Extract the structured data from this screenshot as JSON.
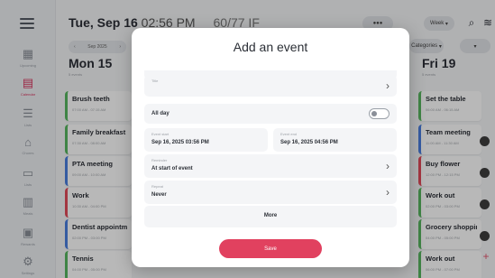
{
  "header": {
    "date": "Tue, Sep 16",
    "time": "02:56 PM",
    "extra": "60/77 IF",
    "view": "Week",
    "categories": "Categories"
  },
  "nav": {
    "range": "Sep 2025"
  },
  "sidebar": {
    "items": [
      {
        "label": "Upcoming",
        "icon": "grid-icon"
      },
      {
        "label": "Calendar",
        "icon": "calendar-icon"
      },
      {
        "label": "Lists",
        "icon": "lists-icon"
      },
      {
        "label": "Chores",
        "icon": "home-icon"
      },
      {
        "label": "Lists",
        "icon": "list-icon"
      },
      {
        "label": "Meals",
        "icon": "meals-icon"
      },
      {
        "label": "Rewards",
        "icon": "rewards-icon"
      },
      {
        "label": "Settings",
        "icon": "settings-icon"
      }
    ]
  },
  "columns": {
    "left": {
      "day": "Mon 15",
      "sub": "5 events",
      "events": [
        {
          "title": "Brush teeth",
          "time": "07:00 AM - 07:15 AM",
          "color": "#58b860"
        },
        {
          "title": "Family breakfast",
          "time": "07:30 AM - 08:00 AM",
          "color": "#58b860"
        },
        {
          "title": "PTA meeting",
          "time": "09:00 AM - 10:00 AM",
          "color": "#4a7fe0"
        },
        {
          "title": "Work",
          "time": "10:30 AM - 04:00 PM",
          "color": "#e24b5a"
        },
        {
          "title": "Dentist appointment",
          "time": "02:00 PM - 03:00 PM",
          "color": "#4a7fe0"
        },
        {
          "title": "Tennis",
          "time": "04:00 PM - 05:00 PM",
          "color": "#58b860"
        }
      ]
    },
    "right": {
      "day": "Fri 19",
      "sub": "5 events",
      "events": [
        {
          "title": "Set the table",
          "time": "06:00 AM - 06:15 AM",
          "color": "#58b860"
        },
        {
          "title": "Team meeting",
          "time": "11:00 AM - 11:30 AM",
          "color": "#4a7fe0"
        },
        {
          "title": "Buy flower",
          "time": "12:00 PM - 12:15 PM",
          "color": "#e24b5a"
        },
        {
          "title": "Work out",
          "time": "02:00 PM - 03:00 PM",
          "color": "#58b860"
        },
        {
          "title": "Grocery shopping",
          "time": "04:00 PM - 05:00 PM",
          "color": "#58b860"
        },
        {
          "title": "Work out",
          "time": "06:00 PM - 07:00 PM",
          "color": "#58b860"
        }
      ]
    }
  },
  "modal": {
    "title": "Add an event",
    "title_field_small": "Title",
    "all_day": "All day",
    "all_day_on": false,
    "start_label": "Event start",
    "start_value": "Sep 16, 2025 03:56 PM",
    "end_label": "Event end",
    "end_value": "Sep 16, 2025 04:56 PM",
    "reminder_label": "Reminder",
    "reminder_value": "At start of event",
    "repeat_label": "Repeat",
    "repeat_value": "Never",
    "more": "More",
    "save": "Save"
  },
  "colors": {
    "accent": "#e1415f",
    "green": "#58b860",
    "red": "#e24b5a",
    "blue": "#4a7fe0"
  }
}
